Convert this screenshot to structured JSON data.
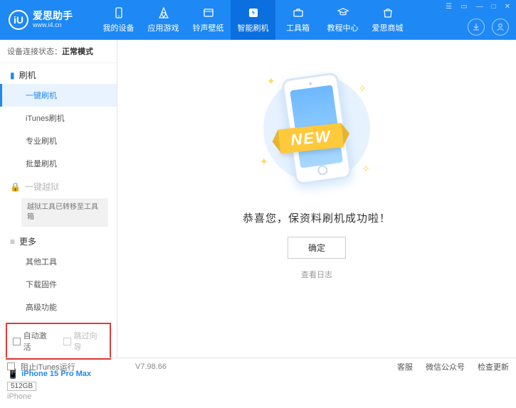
{
  "app": {
    "title": "爱思助手",
    "subtitle": "www.i4.cn",
    "logo_letter": "iU"
  },
  "nav": {
    "items": [
      {
        "label": "我的设备"
      },
      {
        "label": "应用游戏"
      },
      {
        "label": "铃声壁纸"
      },
      {
        "label": "智能刷机"
      },
      {
        "label": "工具箱"
      },
      {
        "label": "教程中心"
      },
      {
        "label": "爱思商城"
      }
    ],
    "active_index": 3
  },
  "status": {
    "label": "设备连接状态：",
    "value": "正常模式"
  },
  "sidebar": {
    "section_flash": "刷机",
    "items_flash": [
      {
        "label": "一键刷机"
      },
      {
        "label": "iTunes刷机"
      },
      {
        "label": "专业刷机"
      },
      {
        "label": "批量刷机"
      }
    ],
    "section_jailbreak": "一键越狱",
    "jailbreak_note": "越狱工具已转移至工具箱",
    "section_more": "更多",
    "items_more": [
      {
        "label": "其他工具"
      },
      {
        "label": "下载固件"
      },
      {
        "label": "高级功能"
      }
    ]
  },
  "checkboxes": {
    "auto_activate": "自动激活",
    "skip_setup": "跳过向导"
  },
  "device": {
    "name": "iPhone 15 Pro Max",
    "storage": "512GB",
    "type": "iPhone"
  },
  "main": {
    "ribbon": "NEW",
    "success_text": "恭喜您，保资料刷机成功啦！",
    "ok_button": "确定",
    "view_log": "查看日志"
  },
  "footer": {
    "block_itunes": "阻止iTunes运行",
    "version": "V7.98.66",
    "links": [
      "客服",
      "微信公众号",
      "检查更新"
    ]
  }
}
